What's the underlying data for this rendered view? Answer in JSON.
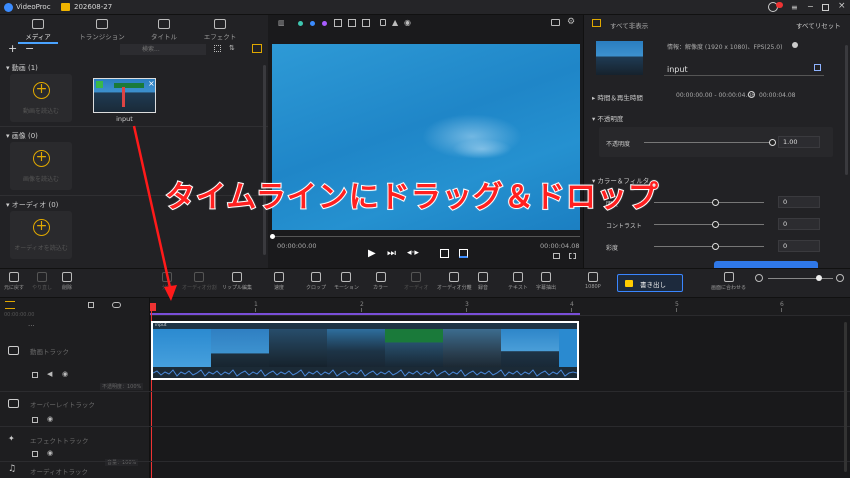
{
  "titlebar": {
    "app_name": "VideoProc",
    "project": "202608-27"
  },
  "left_tabs": [
    {
      "label": "メディア"
    },
    {
      "label": "トランジション"
    },
    {
      "label": "タイトル"
    },
    {
      "label": "エフェクト"
    }
  ],
  "media": {
    "search_placeholder": "検索...",
    "video_section": "動画 (1)",
    "video_add_label": "動画を読込む",
    "clip_name": "input",
    "image_section": "画像 (0)",
    "image_add_label": "画像を読込む",
    "audio_section": "オーディオ (0)",
    "audio_add_label": "オーディオを読込む"
  },
  "preview": {
    "time_current": "00:00:00.00",
    "time_total": "00:00:04.08"
  },
  "right_panel": {
    "reset_section": "すべて非表示",
    "reset_all": "すべてリセット",
    "info_text": "情報：解像度 (1920 x 1080)、FPS(25.0)",
    "clip_name": "input",
    "time_section": "時間＆再生時間",
    "time_range": "00:00:00.00 - 00:00:04.08",
    "duration": "00:00:04.08",
    "opacity_section": "不透明度",
    "opacity_label": "不透明度",
    "opacity_value": "1.00",
    "color_section": "カラー＆フィルタ",
    "brightness_label": "明度",
    "brightness_value": "0",
    "contrast_label": "コントラスト",
    "contrast_value": "0",
    "saturation_label": "彩度",
    "saturation_value": "0"
  },
  "toolbar": {
    "undo": "元に戻す",
    "redo": "やり直し",
    "delete": "削除",
    "split": "分割",
    "audio_split": "オーディオ分割",
    "ripple": "リップル編集",
    "speed": "速度",
    "crop": "クロップ",
    "motion": "モーション",
    "color": "カラー",
    "audio": "オーディオ",
    "audio_detach": "オーディオ分離",
    "record": "録音",
    "text": "テキスト",
    "subtitle": "字幕抽出",
    "resolution": "1080P",
    "export": "書き出し",
    "fit": "画面に合わせる"
  },
  "timeline": {
    "timecode": "00:00:00.00",
    "ruler": [
      "1",
      "2",
      "3",
      "4",
      "5",
      "6"
    ],
    "video_track": "動画トラック",
    "overlay_track": "オーバーレイトラック",
    "effect_track": "エフェクトトラック",
    "audio_track": "オーディオトラック",
    "opacity_badge": "不透明度：100%",
    "volume_badge": "音量：100%",
    "clip_label": "input"
  },
  "overlay_caption": "タイムラインにドラッグ＆ドロップ",
  "colors": {
    "accent": "#4aa3ff",
    "add": "#e0a800",
    "caption": "#ff2020",
    "export": "#ffcc00"
  }
}
